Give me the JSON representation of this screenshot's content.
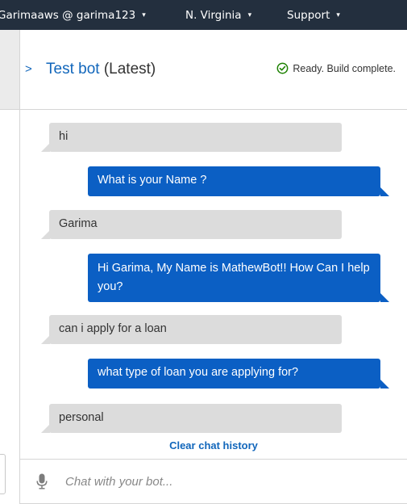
{
  "topbar": {
    "account": "Garimaaws @ garima123",
    "region": "N. Virginia",
    "support": "Support",
    "caret": "▾"
  },
  "bot": {
    "name": "Test bot",
    "version": "(Latest)",
    "status": "Ready. Build complete.",
    "expand_glyph": ">"
  },
  "messages": [
    {
      "sender": "user",
      "text": "hi"
    },
    {
      "sender": "bot",
      "text": "What is your Name ?"
    },
    {
      "sender": "user",
      "text": "Garima"
    },
    {
      "sender": "bot",
      "text": "Hi Garima, My Name is MathewBot!! How Can I help you?"
    },
    {
      "sender": "user",
      "text": "can i apply for a loan"
    },
    {
      "sender": "bot",
      "text": "what type of loan you are applying for?"
    },
    {
      "sender": "user",
      "text": "personal"
    }
  ],
  "clear_history_label": "Clear chat history",
  "input": {
    "placeholder": "Chat with your bot...",
    "value": ""
  },
  "colors": {
    "topbar_bg": "#232f3e",
    "link_blue": "#1166bb",
    "bot_bubble": "#0b5fc4",
    "user_bubble": "#dcdcdc",
    "success_green": "#1d8102"
  }
}
